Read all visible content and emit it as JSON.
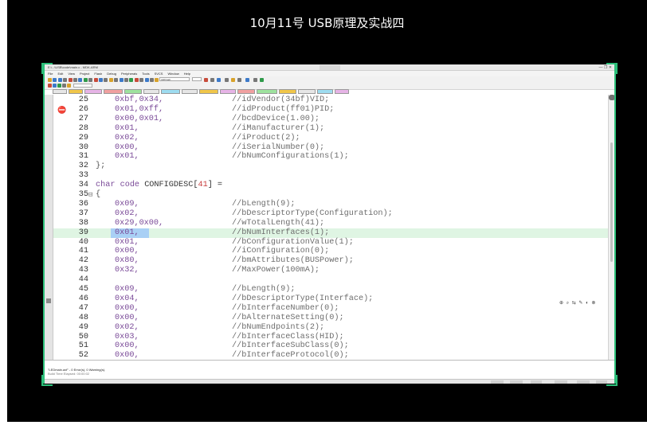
{
  "video": {
    "title": "10月11号 USB原理及实战四"
  },
  "ide": {
    "title_text": "E:\\...\\USB\\code\\main.c - MDK-ARM",
    "menu": [
      "File",
      "Edit",
      "View",
      "Project",
      "Flash",
      "Debug",
      "Peripherals",
      "Tools",
      "SVCS",
      "Window",
      "Help"
    ],
    "toolbar_combo": "LEDmain",
    "window_buttons": "— ❐ ✕",
    "minimap_icons": "⊕ ⌕ ⇆ ✎ ◐ ⊗"
  },
  "code_lines": [
    {
      "n": "25",
      "val": "0xbf,0x34,",
      "com": "//idVendor(34bf)VID;"
    },
    {
      "n": "26",
      "val": "0x01,0xff,",
      "com": "//idProduct(ff01)PID;",
      "bookmark": "⛔"
    },
    {
      "n": "27",
      "val": "0x00,0x01,",
      "com": "//bcdDevice(1.00);"
    },
    {
      "n": "28",
      "val": "0x01,",
      "com": "//iManufacturer(1);"
    },
    {
      "n": "29",
      "val": "0x02,",
      "com": "//iProduct(2);"
    },
    {
      "n": "30",
      "val": "0x00,",
      "com": "//iSerialNumber(0);"
    },
    {
      "n": "31",
      "val": "0x01,",
      "com": "//bNumConfigurations(1);"
    },
    {
      "n": "32",
      "brace": "};"
    },
    {
      "n": "33"
    },
    {
      "n": "34",
      "decl": true
    },
    {
      "n": "35",
      "fold": "⊟",
      "brace": "{"
    },
    {
      "n": "36",
      "val": "0x09,",
      "com": "//bLength(9);"
    },
    {
      "n": "37",
      "val": "0x02,",
      "com": "//bDescriptorType(Configuration);"
    },
    {
      "n": "38",
      "val": "0x29,0x00,",
      "com": "//wTotalLength(41);"
    },
    {
      "n": "39",
      "val": "0x01,",
      "com": "//bNumInterfaces(1);",
      "active": true
    },
    {
      "n": "40",
      "val": "0x01,",
      "com": "//bConfigurationValue(1);"
    },
    {
      "n": "41",
      "val": "0x00,",
      "com": "//iConfiguration(0);"
    },
    {
      "n": "42",
      "val": "0x80,",
      "com": "//bmAttributes(BUSPower);"
    },
    {
      "n": "43",
      "val": "0x32,",
      "com": "//MaxPower(100mA);"
    },
    {
      "n": "44"
    },
    {
      "n": "45",
      "val": "0x09,",
      "com": "//bLength(9);"
    },
    {
      "n": "46",
      "val": "0x04,",
      "com": "//bDescriptorType(Interface);"
    },
    {
      "n": "47",
      "val": "0x00,",
      "com": "//bInterfaceNumber(0);"
    },
    {
      "n": "48",
      "val": "0x00,",
      "com": "//bAlternateSetting(0);"
    },
    {
      "n": "49",
      "val": "0x02,",
      "com": "//bNumEndpoints(2);"
    },
    {
      "n": "50",
      "val": "0x03,",
      "com": "//bInterfaceClass(HID);"
    },
    {
      "n": "51",
      "val": "0x00,",
      "com": "//bInterfaceSubClass(0);"
    },
    {
      "n": "52",
      "val": "0x00,",
      "com": "//bInterfaceProtocol(0);"
    }
  ],
  "decl": {
    "kw1": "char",
    "kw2": "code",
    "name": "CONFIGDESC",
    "open": "[",
    "size": "41",
    "close": "]",
    "tail": " ="
  },
  "panel": {
    "line1": "\"LEDmain.axf\" - 0 Error(s), 0 Warning(s).",
    "line2": "Build Time Elapsed: 00:00:02"
  }
}
